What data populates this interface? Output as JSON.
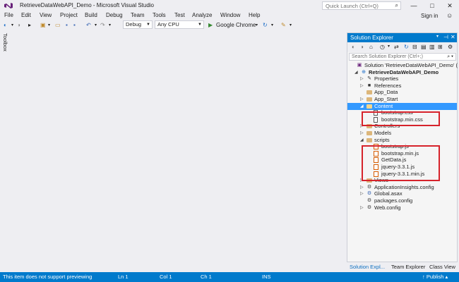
{
  "window": {
    "title": "RetrieveDataWebAPI_Demo - Microsoft Visual Studio",
    "quick_launch_placeholder": "Quick Launch (Ctrl+Q)",
    "minimize": "—",
    "maximize": "□",
    "close": "✕"
  },
  "menu": [
    "File",
    "Edit",
    "View",
    "Project",
    "Build",
    "Debug",
    "Team",
    "Tools",
    "Test",
    "Analyze",
    "Window",
    "Help"
  ],
  "sign_in": "Sign in",
  "toolbar": {
    "config": "Debug",
    "platform": "Any CPU",
    "run_target": "Google Chrome"
  },
  "toolbox_label": "Toolbox",
  "solution_explorer": {
    "title": "Solution Explorer",
    "search_placeholder": "Search Solution Explorer (Ctrl+;)",
    "items": [
      {
        "label": "Solution 'RetrieveDataWebAPI_Demo' (",
        "icon": "solution-icon",
        "level": 0,
        "tri": ""
      },
      {
        "label": "RetrieveDataWebAPI_Demo",
        "icon": "project-icon",
        "level": 1,
        "tri": "◢"
      },
      {
        "label": "Properties",
        "icon": "wrench-icon",
        "level": 2,
        "tri": "▷"
      },
      {
        "label": "References",
        "icon": "references-icon",
        "level": 2,
        "tri": "▷"
      },
      {
        "label": "App_Data",
        "icon": "folder-icon",
        "level": 2,
        "tri": ""
      },
      {
        "label": "App_Start",
        "icon": "folder-icon",
        "level": 2,
        "tri": "▷"
      },
      {
        "label": "Content",
        "icon": "folder-icon",
        "level": 2,
        "tri": "◢"
      },
      {
        "label": "bootstrap.css",
        "icon": "css-file-icon",
        "level": 3,
        "tri": ""
      },
      {
        "label": "bootstrap.min.css",
        "icon": "css-file-icon",
        "level": 3,
        "tri": ""
      },
      {
        "label": "Controllers",
        "icon": "folder-icon",
        "level": 2,
        "tri": "▷"
      },
      {
        "label": "Models",
        "icon": "folder-icon",
        "level": 2,
        "tri": "▷"
      },
      {
        "label": "scripts",
        "icon": "folder-icon",
        "level": 2,
        "tri": "◢"
      },
      {
        "label": "bootstrap.js",
        "icon": "js-file-icon",
        "level": 3,
        "tri": ""
      },
      {
        "label": "bootstrap.min.js",
        "icon": "js-file-icon",
        "level": 3,
        "tri": ""
      },
      {
        "label": "GetData.js",
        "icon": "js-file-icon",
        "level": 3,
        "tri": ""
      },
      {
        "label": "jquery-3.3.1.js",
        "icon": "js-file-icon",
        "level": 3,
        "tri": ""
      },
      {
        "label": "jquery-3.3.1.min.js",
        "icon": "js-file-icon",
        "level": 3,
        "tri": ""
      },
      {
        "label": "Views",
        "icon": "folder-icon",
        "level": 2,
        "tri": "▷"
      },
      {
        "label": "ApplicationInsights.config",
        "icon": "config-file-icon",
        "level": 2,
        "tri": "▷"
      },
      {
        "label": "Global.asax",
        "icon": "asax-file-icon",
        "level": 2,
        "tri": "▷"
      },
      {
        "label": "packages.config",
        "icon": "config-file-icon",
        "level": 2,
        "tri": ""
      },
      {
        "label": "Web.config",
        "icon": "config-file-icon",
        "level": 2,
        "tri": "▷"
      }
    ],
    "selected_index": 6,
    "tabs": [
      "Solution Expl...",
      "Team Explorer",
      "Class View"
    ]
  },
  "status": {
    "message": "This item does not support previewing",
    "line": "Ln 1",
    "col": "Col 1",
    "ch": "Ch 1",
    "mode": "INS",
    "publish": "↑ Publish ▴"
  },
  "colors": {
    "accent": "#007acc",
    "highlight": "#d6232b",
    "selection": "#3399ff"
  }
}
